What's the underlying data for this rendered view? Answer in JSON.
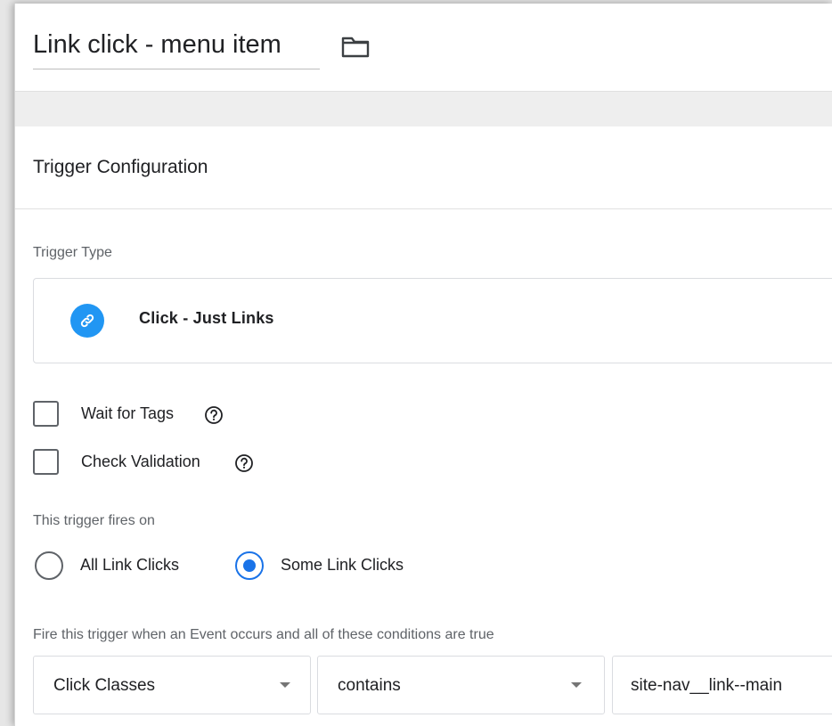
{
  "header": {
    "title": "Link click - menu item",
    "folder_icon": "folder-icon"
  },
  "card": {
    "title": "Trigger Configuration",
    "trigger_type_label": "Trigger Type",
    "trigger_type": {
      "label": "Click - Just Links",
      "icon": "link-icon",
      "icon_color": "#2196f3"
    },
    "checkboxes": [
      {
        "label": "Wait for Tags",
        "checked": false,
        "help_icon": "help-icon"
      },
      {
        "label": "Check Validation",
        "checked": false,
        "help_icon": "help-icon"
      }
    ],
    "fires_on_label": "This trigger fires on",
    "radios": [
      {
        "label": "All Link Clicks",
        "selected": false
      },
      {
        "label": "Some Link Clicks",
        "selected": true
      }
    ],
    "condition_label": "Fire this trigger when an Event occurs and all of these conditions are true",
    "condition": {
      "variable": "Click Classes",
      "operator": "contains",
      "value": "site-nav__link--main"
    }
  },
  "colors": {
    "accent": "#1a73e8",
    "link_icon_bg": "#2196f3",
    "band": "#eeeeee"
  }
}
